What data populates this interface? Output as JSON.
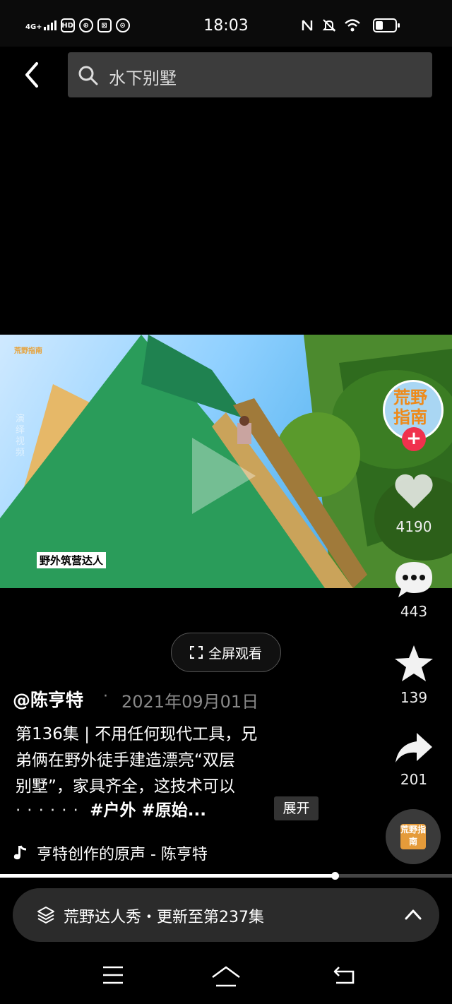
{
  "status_bar": {
    "network": "4G+",
    "badges": [
      "HD",
      "⊕",
      "⊠",
      "⊙"
    ],
    "time": "18:03",
    "icons": [
      "nfc-icon",
      "mute-icon",
      "wifi-icon",
      "battery-icon"
    ],
    "battery_level": 0.3
  },
  "header": {
    "back_icon": "chevron-left-icon",
    "search_icon": "search-icon",
    "search_query": "水下别墅"
  },
  "video": {
    "watermark_logo": "荒野指南",
    "vertical_text": "演绎视频",
    "caption_tag": "野外筑营达人",
    "play_icon": "play-icon"
  },
  "actions": {
    "avatar_text": "荒野指南",
    "follow_label": "+",
    "like_count": "4190",
    "comment_count": "443",
    "favorite_count": "139",
    "share_count": "201"
  },
  "fullscreen": {
    "label": "全屏观看"
  },
  "post": {
    "author": "@陈亨特",
    "separator": "·",
    "date": "2021年09月01日",
    "desc_line1": "第136集 | 不用任何现代工具，兄",
    "desc_line2": "弟俩在野外徒手建造漂亮“双层",
    "desc_line3": "别墅”，家具齐全，这技术可以",
    "desc_dots": "······",
    "desc_tags": "#户外 #原始...",
    "expand_label": "展开"
  },
  "music": {
    "icon": "tiktok-note-icon",
    "text": "亨特创作的原声 - 陈亨特",
    "disc_text": "荒野指南"
  },
  "playback": {
    "progress": 0.74
  },
  "series_bar": {
    "icon": "layers-icon",
    "text": "荒野达人秀・更新至第237集",
    "chevron": "chevron-up-icon"
  },
  "nav": [
    "menu-icon",
    "home-icon",
    "back-icon"
  ]
}
